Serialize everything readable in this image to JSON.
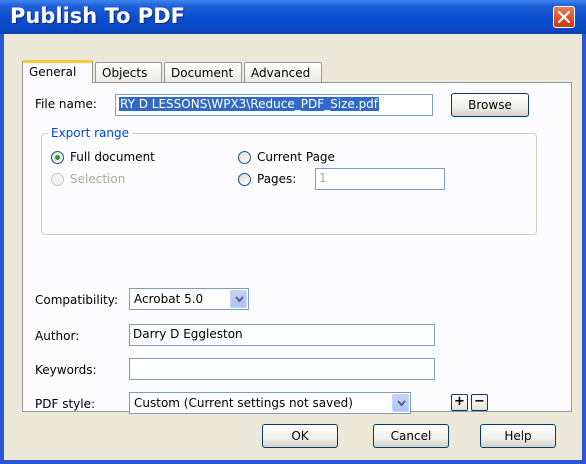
{
  "window": {
    "title": "Publish To PDF"
  },
  "tabs": [
    {
      "label": "General",
      "active": true
    },
    {
      "label": "Objects"
    },
    {
      "label": "Document"
    },
    {
      "label": "Advanced"
    }
  ],
  "file": {
    "label": "File name:",
    "value": "RY D LESSONS\\WPX3\\Reduce_PDF_Size.pdf",
    "browse_label": "Browse"
  },
  "export_range": {
    "title": "Export range",
    "full_document": "Full document",
    "current_page": "Current Page",
    "selection": "Selection",
    "pages": "Pages:",
    "pages_value": "1",
    "selected": "full_document"
  },
  "compatibility": {
    "label": "Compatibility:",
    "value": "Acrobat 5.0"
  },
  "author": {
    "label": "Author:",
    "value": "Darry D Eggleston"
  },
  "keywords": {
    "label": "Keywords:",
    "value": ""
  },
  "pdf_style": {
    "label": "PDF style:",
    "value": "Custom (Current settings not saved)",
    "add_label": "+",
    "remove_label": "−"
  },
  "buttons": {
    "ok": "OK",
    "cancel": "Cancel",
    "help": "Help"
  },
  "icons": {
    "close": "close-icon",
    "dropdown": "chevron-down-icon"
  },
  "colors": {
    "titlebar": "#0a4ccd",
    "dialog_bg": "#ece9d8",
    "selection": "#316ac5",
    "group_title": "#0046d5"
  }
}
